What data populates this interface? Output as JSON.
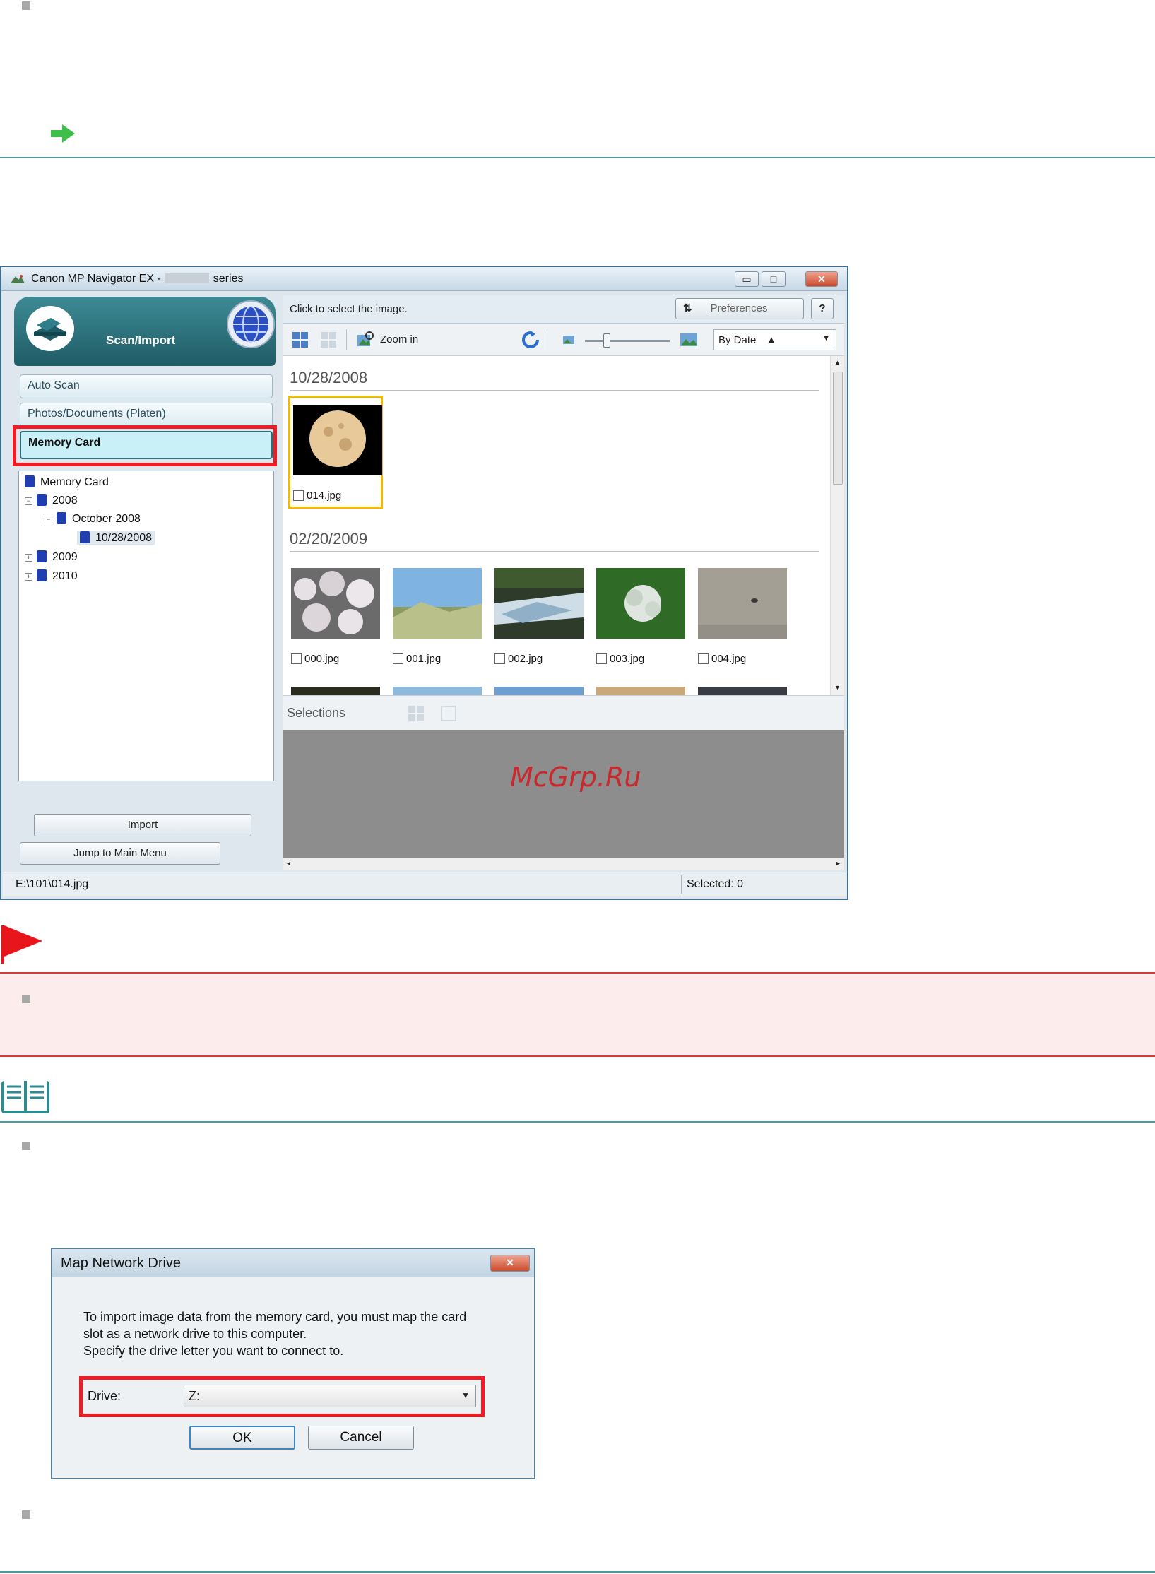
{
  "window": {
    "title": "Canon MP Navigator EX -",
    "title_suffix": "series",
    "buttons": {
      "minimize": "▭",
      "maximize": "□",
      "close": "✕"
    }
  },
  "left_pane": {
    "header_label": "Scan/Import",
    "nav": {
      "auto_scan": "Auto Scan",
      "photos_documents": "Photos/Documents (Platen)",
      "memory_card": "Memory Card"
    },
    "tree": {
      "root": "Memory Card",
      "y2008": "2008",
      "oct2008": "October 2008",
      "d20081028": "10/28/2008",
      "y2009": "2009",
      "y2010": "2010"
    },
    "import_button": "Import",
    "main_menu_button": "Jump to Main Menu"
  },
  "right_pane": {
    "instruction": "Click to select the image.",
    "preferences_button": "Preferences",
    "help_button": "?",
    "zoom_in_label": "Zoom in",
    "sort_selected": "By Date",
    "groups": [
      {
        "date": "10/28/2008",
        "files": [
          "014.jpg"
        ]
      },
      {
        "date": "02/20/2009",
        "files": [
          "000.jpg",
          "001.jpg",
          "002.jpg",
          "003.jpg",
          "004.jpg"
        ]
      }
    ],
    "selections_label": "Selections",
    "watermark": "McGrp.Ru"
  },
  "status_bar": {
    "path": "E:\\101\\014.jpg",
    "selected": "Selected: 0"
  },
  "dialog": {
    "title": "Map Network Drive",
    "text_line1": "To import image data from the memory card, you must map the card",
    "text_line2": "slot as a network drive to this computer.",
    "text_line3": "Specify the drive letter you want to connect to.",
    "drive_label": "Drive:",
    "drive_value": "Z:",
    "ok": "OK",
    "cancel": "Cancel"
  },
  "colors": {
    "teal_rule": "#4a9a9e",
    "red_highlight": "#ee1c25",
    "caution_bg": "#fdecec",
    "caution_rule": "#d23b3b",
    "watermark": "#c9282d"
  }
}
